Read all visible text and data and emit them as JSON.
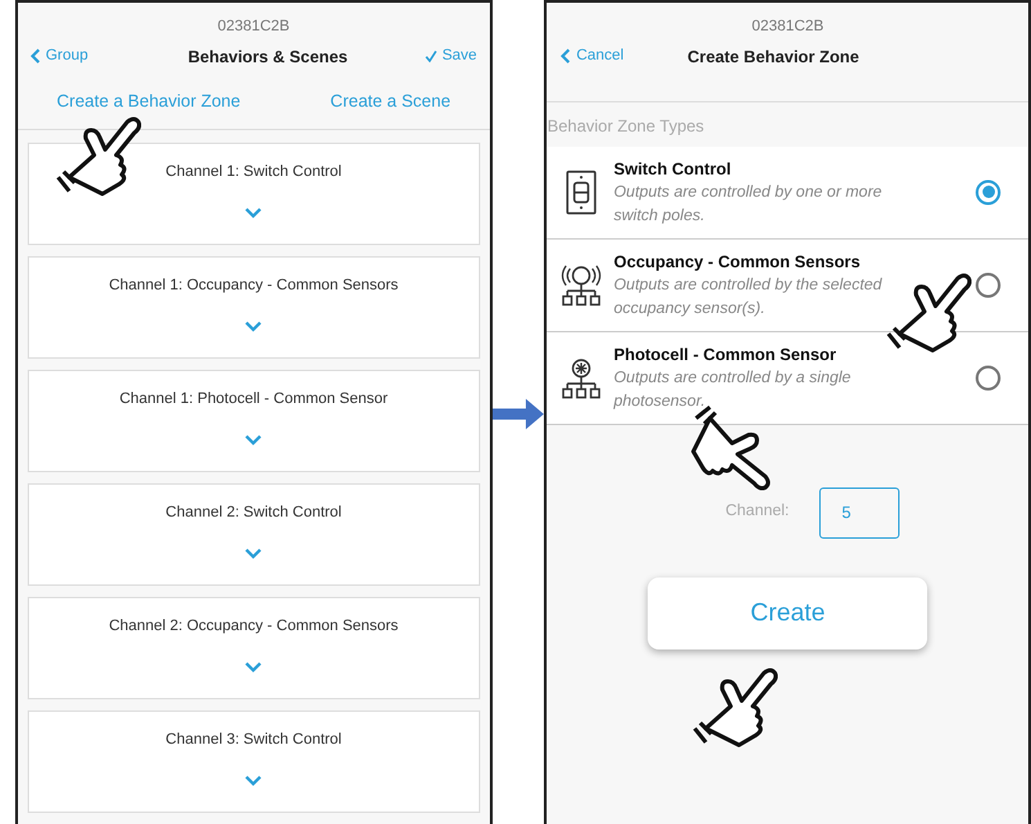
{
  "left_screen": {
    "serial": "02381C2B",
    "back": "Group",
    "title": "Behaviors & Scenes",
    "save": "Save",
    "actions": [
      "Create a Behavior Zone",
      "Create a Scene"
    ],
    "zones": [
      {
        "label": "Channel 1: Switch Control"
      },
      {
        "label": "Channel 1: Occupancy - Common Sensors"
      },
      {
        "label": "Channel 1: Photocell - Common Sensor"
      },
      {
        "label": "Channel 2: Switch Control"
      },
      {
        "label": "Channel 2: Occupancy - Common Sensors"
      },
      {
        "label": "Channel 3: Switch Control"
      }
    ]
  },
  "right_screen": {
    "serial": "02381C2B",
    "back": "Cancel",
    "title": "Create Behavior Zone",
    "section": "Behavior Zone Types",
    "types": [
      {
        "kind": "switch",
        "name": "Switch Control",
        "description": "Outputs are controlled by one or more switch poles.",
        "selected": true
      },
      {
        "kind": "occupancy",
        "name": "Occupancy - Common Sensors",
        "description": "Outputs are controlled by the selected occupancy sensor(s).",
        "selected": false
      },
      {
        "kind": "photocell",
        "name": "Photocell - Common Sensor",
        "description": "Outputs are controlled by a single photosensor.",
        "selected": false
      }
    ],
    "channel_label": "Channel:",
    "channel_value": "5",
    "create": "Create"
  }
}
